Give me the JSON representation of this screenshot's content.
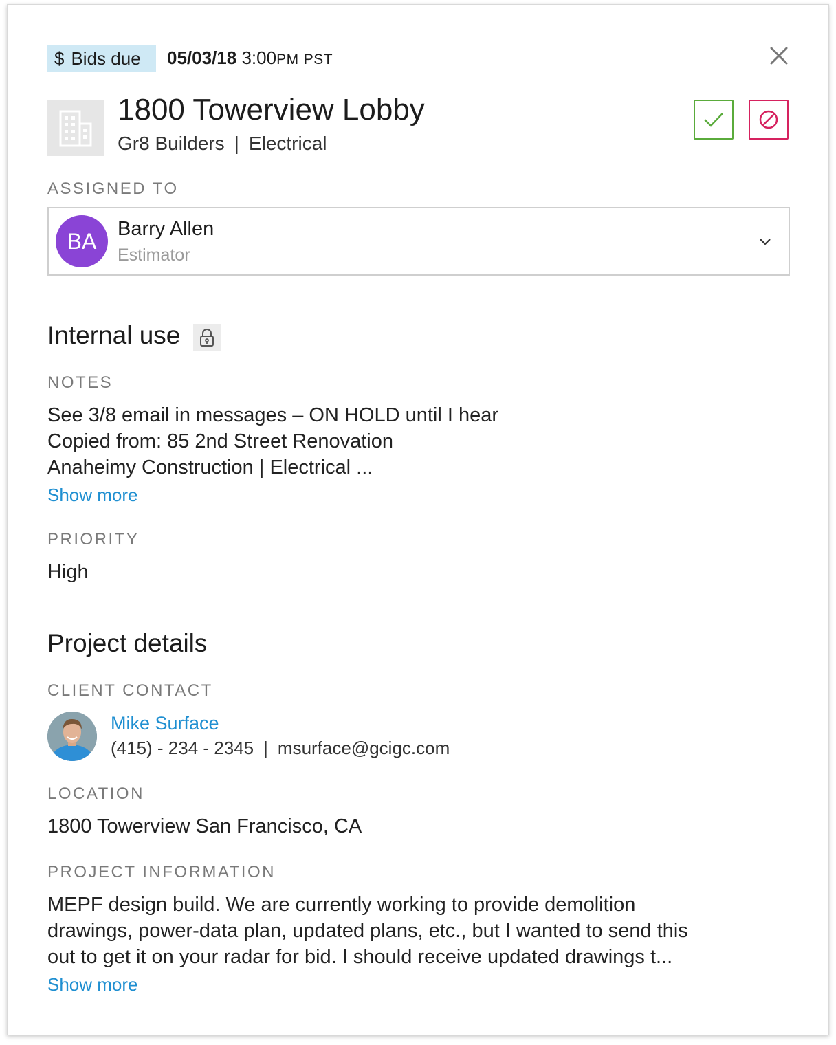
{
  "header": {
    "badge_currency_symbol": "$",
    "badge_label": "Bids due",
    "due_date": "05/03/18",
    "due_time": "3:00",
    "due_ampm": "PM",
    "due_tz": "PST"
  },
  "project": {
    "title": "1800 Towerview Lobby",
    "company": "Gr8 Builders",
    "separator": "|",
    "trade": "Electrical"
  },
  "assigned": {
    "label": "ASSIGNED TO",
    "initials": "BA",
    "name": "Barry Allen",
    "role": "Estimator"
  },
  "internal": {
    "heading": "Internal use",
    "notes_label": "NOTES",
    "notes_lines": [
      "See 3/8 email in messages – ON HOLD until I hear",
      "Copied from: 85 2nd Street Renovation",
      "Anaheimy Construction  |  Electrical ..."
    ],
    "notes_show_more": "Show more",
    "priority_label": "PRIORITY",
    "priority_value": "High"
  },
  "details": {
    "heading": "Project details",
    "client_label": "CLIENT CONTACT",
    "contact_name": "Mike Surface",
    "contact_phone": "(415) - 234 - 2345",
    "contact_separator": "|",
    "contact_email": "msurface@gcigc.com",
    "location_label": "LOCATION",
    "location_value": "1800 Towerview San Francisco, CA",
    "info_label": "PROJECT INFORMATION",
    "info_lines": [
      "MEPF design build. We are currently working to provide demolition",
      "drawings, power-data plan, updated plans, etc., but I wanted to send this",
      "out to get it on your radar for bid. I should receive updated drawings t..."
    ],
    "info_show_more": "Show more"
  },
  "colors": {
    "badge_bg": "#cfe9f5",
    "accept": "#5aab3b",
    "decline": "#d6225f",
    "avatar": "#8a44d6",
    "link": "#1f8fd1"
  },
  "icons": [
    "close-icon",
    "building-icon",
    "check-icon",
    "block-icon",
    "chevron-down-icon",
    "lock-icon"
  ]
}
